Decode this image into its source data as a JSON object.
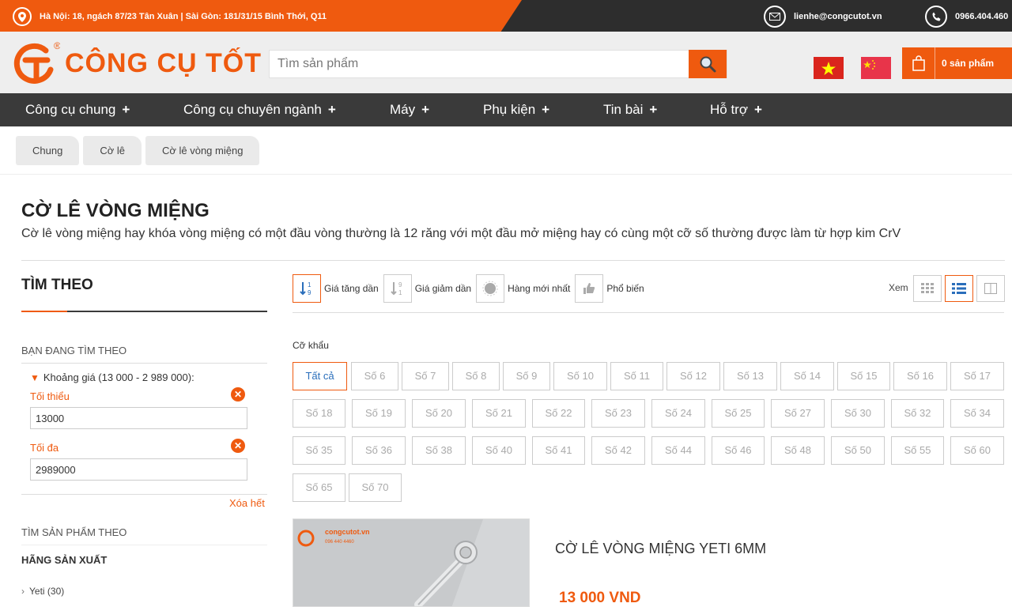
{
  "topbar": {
    "address": "Hà Nội: 18, ngách 87/23 Tân Xuân | Sài Gòn: 181/31/15 Bình Thới, Q11",
    "email": "lienhe@congcutot.vn",
    "phone": "0966.404.460",
    "icons": [
      "location-icon",
      "mail-icon",
      "phone-icon"
    ]
  },
  "header": {
    "logo_text": "CÔNG CỤ TỐT",
    "logo_mark": "®",
    "search_placeholder": "Tìm sản phẩm",
    "cart_label": "0 sản phẩm",
    "accent": "#ef5a0f"
  },
  "nav": {
    "items": [
      {
        "label": "Công cụ chung",
        "plus": "+"
      },
      {
        "label": "Công cụ chuyên ngành",
        "plus": "+"
      },
      {
        "label": "Máy",
        "plus": "+"
      },
      {
        "label": "Phụ kiện",
        "plus": "+"
      },
      {
        "label": "Tin bài",
        "plus": "+"
      },
      {
        "label": "Hỗ trợ",
        "plus": "+"
      }
    ]
  },
  "breadcrumb": [
    "Chung",
    "Cờ lê",
    "Cờ lê vòng miệng"
  ],
  "category": {
    "title": "CỜ LÊ VÒNG MIỆNG",
    "description": "Cờ lê vòng miệng hay khóa vòng miệng có một đầu vòng thường là 12 răng với một đầu mở miệng hay có cùng một cỡ số thường được làm từ hợp kim CrV"
  },
  "sidebar": {
    "title": "TÌM THEO",
    "current_heading": "BẠN ĐANG TÌM THEO",
    "price_label": "Khoảng giá (13 000 - 2 989 000):",
    "min_label": "Tối thiểu",
    "min_value": "13000",
    "max_label": "Tối đa",
    "max_value": "2989000",
    "clear_label": "Xóa hết",
    "search_by_heading": "TÌM SẢN PHẨM THEO",
    "brand_heading": "HÃNG SẢN XUẤT",
    "brands": [
      {
        "label": "Yeti (30)"
      }
    ]
  },
  "sort": {
    "options": [
      {
        "label": "Giá tăng dần",
        "icon": "sort-asc-icon",
        "active": true
      },
      {
        "label": "Giá giảm dần",
        "icon": "sort-desc-icon",
        "active": false
      },
      {
        "label": "Hàng mới nhất",
        "icon": "new-icon",
        "active": false
      },
      {
        "label": "Phổ biến",
        "icon": "thumbs-up-icon",
        "active": false
      }
    ],
    "view_label": "Xem",
    "views": [
      "grid-view-icon",
      "list-view-icon",
      "column-view-icon"
    ],
    "active_view": "list-view-icon"
  },
  "sizes": {
    "label": "Cỡ khẩu",
    "chips": [
      "Tất cả",
      "Số 6",
      "Số 7",
      "Số 8",
      "Số 9",
      "Số 10",
      "Số 11",
      "Số 12",
      "Số 13",
      "Số 14",
      "Số 15",
      "Số 16",
      "Số 17",
      "Số 18",
      "Số 19",
      "Số 20",
      "Số 21",
      "Số 22",
      "Số 23",
      "Số 24",
      "Số 25",
      "Số 27",
      "Số 30",
      "Số 32",
      "Số 34",
      "Số 35",
      "Số 36",
      "Số 38",
      "Số 40",
      "Số 41",
      "Số 42",
      "Số 44",
      "Số 46",
      "Số 48",
      "Số 50",
      "Số 55",
      "Số 60",
      "Số 65",
      "Số 70"
    ],
    "active": "Tất cả"
  },
  "product": {
    "name": "CỜ LÊ VÒNG MIỆNG YETI 6MM",
    "price": "13 000 VND",
    "image_watermark": "congcutot.vn",
    "image_phone": "096 440 4460"
  }
}
